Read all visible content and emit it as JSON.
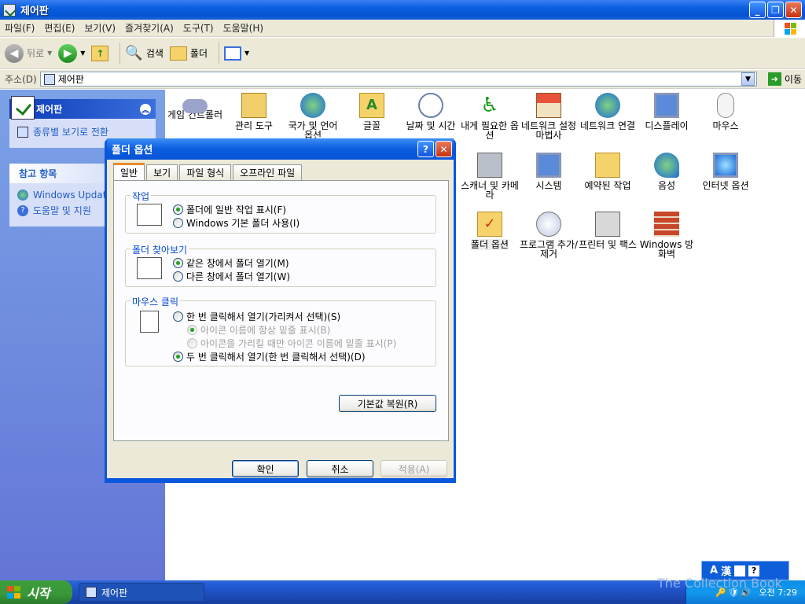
{
  "window": {
    "title": "제어판",
    "min": "_",
    "max": "❐",
    "close": "✕"
  },
  "menu": [
    "파일(F)",
    "편집(E)",
    "보기(V)",
    "즐겨찾기(A)",
    "도구(T)",
    "도움말(H)"
  ],
  "toolbar": {
    "back": "뒤로",
    "search": "검색",
    "folders": "폴더"
  },
  "address": {
    "label": "주소(D)",
    "value": "제어판",
    "go": "이동"
  },
  "sidebar": {
    "panel1": {
      "title": "제어판",
      "link": "종류별 보기로 전환"
    },
    "panel2": {
      "title": "참고 항목",
      "links": [
        "Windows Update",
        "도움말 및 지원"
      ]
    }
  },
  "icons": [
    {
      "label": "게임 컨트롤러",
      "icon": "gamepad-icon"
    },
    {
      "label": "관리 도구",
      "icon": "admin-tools-icon"
    },
    {
      "label": "국가 및 언어 옵션",
      "icon": "globe-icon"
    },
    {
      "label": "글꼴",
      "icon": "fonts-folder-icon"
    },
    {
      "label": "날짜 및 시간",
      "icon": "clock-icon"
    },
    {
      "label": "내게 필요한 옵션",
      "icon": "accessibility-icon"
    },
    {
      "label": "네트워크 설정 마법사",
      "icon": "network-wizard-icon"
    },
    {
      "label": "네트워크 연결",
      "icon": "network-globe-icon"
    },
    {
      "label": "디스플레이",
      "icon": "display-icon"
    },
    {
      "label": "마우스",
      "icon": "mouse-icon"
    },
    {
      "label": "스캐너 및 카메라",
      "icon": "scanner-icon"
    },
    {
      "label": "시스템",
      "icon": "system-icon"
    },
    {
      "label": "예약된 작업",
      "icon": "scheduled-tasks-icon"
    },
    {
      "label": "음성",
      "icon": "speech-icon"
    },
    {
      "label": "인터넷 옵션",
      "icon": "internet-icon"
    },
    {
      "label": "폴더 옵션",
      "icon": "folder-options-icon"
    },
    {
      "label": "프로그램 추가/제거",
      "icon": "add-remove-icon"
    },
    {
      "label": "프린터 및 팩스",
      "icon": "printer-icon"
    },
    {
      "label": "Windows 방화벽",
      "icon": "firewall-icon"
    }
  ],
  "dialog": {
    "title": "폴더 옵션",
    "help": "?",
    "close": "✕",
    "tabs": [
      "일반",
      "보기",
      "파일 형식",
      "오프라인 파일"
    ],
    "group1": {
      "label": "작업",
      "opt1": "폴더에 일반 작업 표시(F)",
      "opt2": "Windows 기본 폴더 사용(I)"
    },
    "group2": {
      "label": "폴더 찾아보기",
      "opt1": "같은 창에서 폴더 열기(M)",
      "opt2": "다른 창에서 폴더 열기(W)"
    },
    "group3": {
      "label": "마우스 클릭",
      "opt1": "한 번 클릭해서 열기(가리켜서 선택)(S)",
      "sub1": "아이콘 이름에 항상 밑줄 표시(B)",
      "sub2": "아이콘을 가리킬 때만 아이콘 이름에 밑줄 표시(P)",
      "opt2": "두 번 클릭해서 열기(한 번 클릭해서 선택)(D)"
    },
    "restore": "기본값 복원(R)",
    "ok": "확인",
    "cancel": "취소",
    "apply": "적용(A)"
  },
  "taskbar": {
    "start": "시작",
    "task": "제어판",
    "clock": "오전 7:29",
    "watermark": "The Collection Book"
  },
  "langbar": {
    "a": "A",
    "han": "漢",
    "help": "?"
  }
}
